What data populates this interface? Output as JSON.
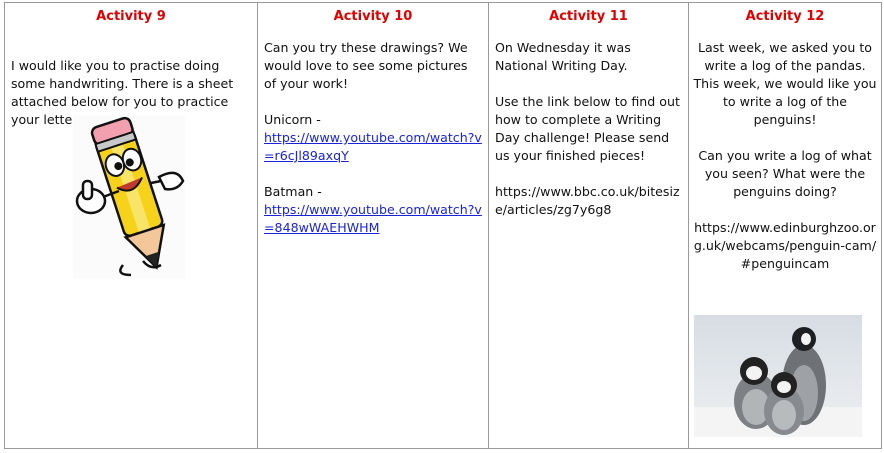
{
  "activities": [
    {
      "title": "Activity 9",
      "text": "I would like you to practise doing some handwriting. There is a sheet attached below for you to practice your letters.",
      "image": "cartoon-pencil-mascot"
    },
    {
      "title": "Activity 10",
      "intro": "Can you try these drawings? We would love to see some pictures of your work!",
      "links": [
        {
          "label": "Unicorn -",
          "url": "https://www.youtube.com/watch?v=r6cJl89axqY"
        },
        {
          "label": "Batman -",
          "url": "https://www.youtube.com/watch?v=848wWAEHWHM"
        }
      ]
    },
    {
      "title": "Activity 11",
      "para1": "On Wednesday it was National Writing Day.",
      "para2": "Use the link below to find out how to complete a Writing Day challenge! Please send us your finished pieces!",
      "url": "https://www.bbc.co.uk/bitesize/articles/zg7y6g8"
    },
    {
      "title": "Activity 12",
      "para1": "Last week, we asked you to write a log of the pandas. This week, we would like you to write a log of the penguins!",
      "para2": "Can you write a log of what you seen? What were the penguins doing?",
      "url": "https://www.edinburghzoo.org.uk/webcams/penguin-cam/#penguincam",
      "image": "penguin-photo"
    }
  ],
  "colors": {
    "title": "#e00000",
    "link": "#1a24d6",
    "border": "#9a9a9a"
  }
}
